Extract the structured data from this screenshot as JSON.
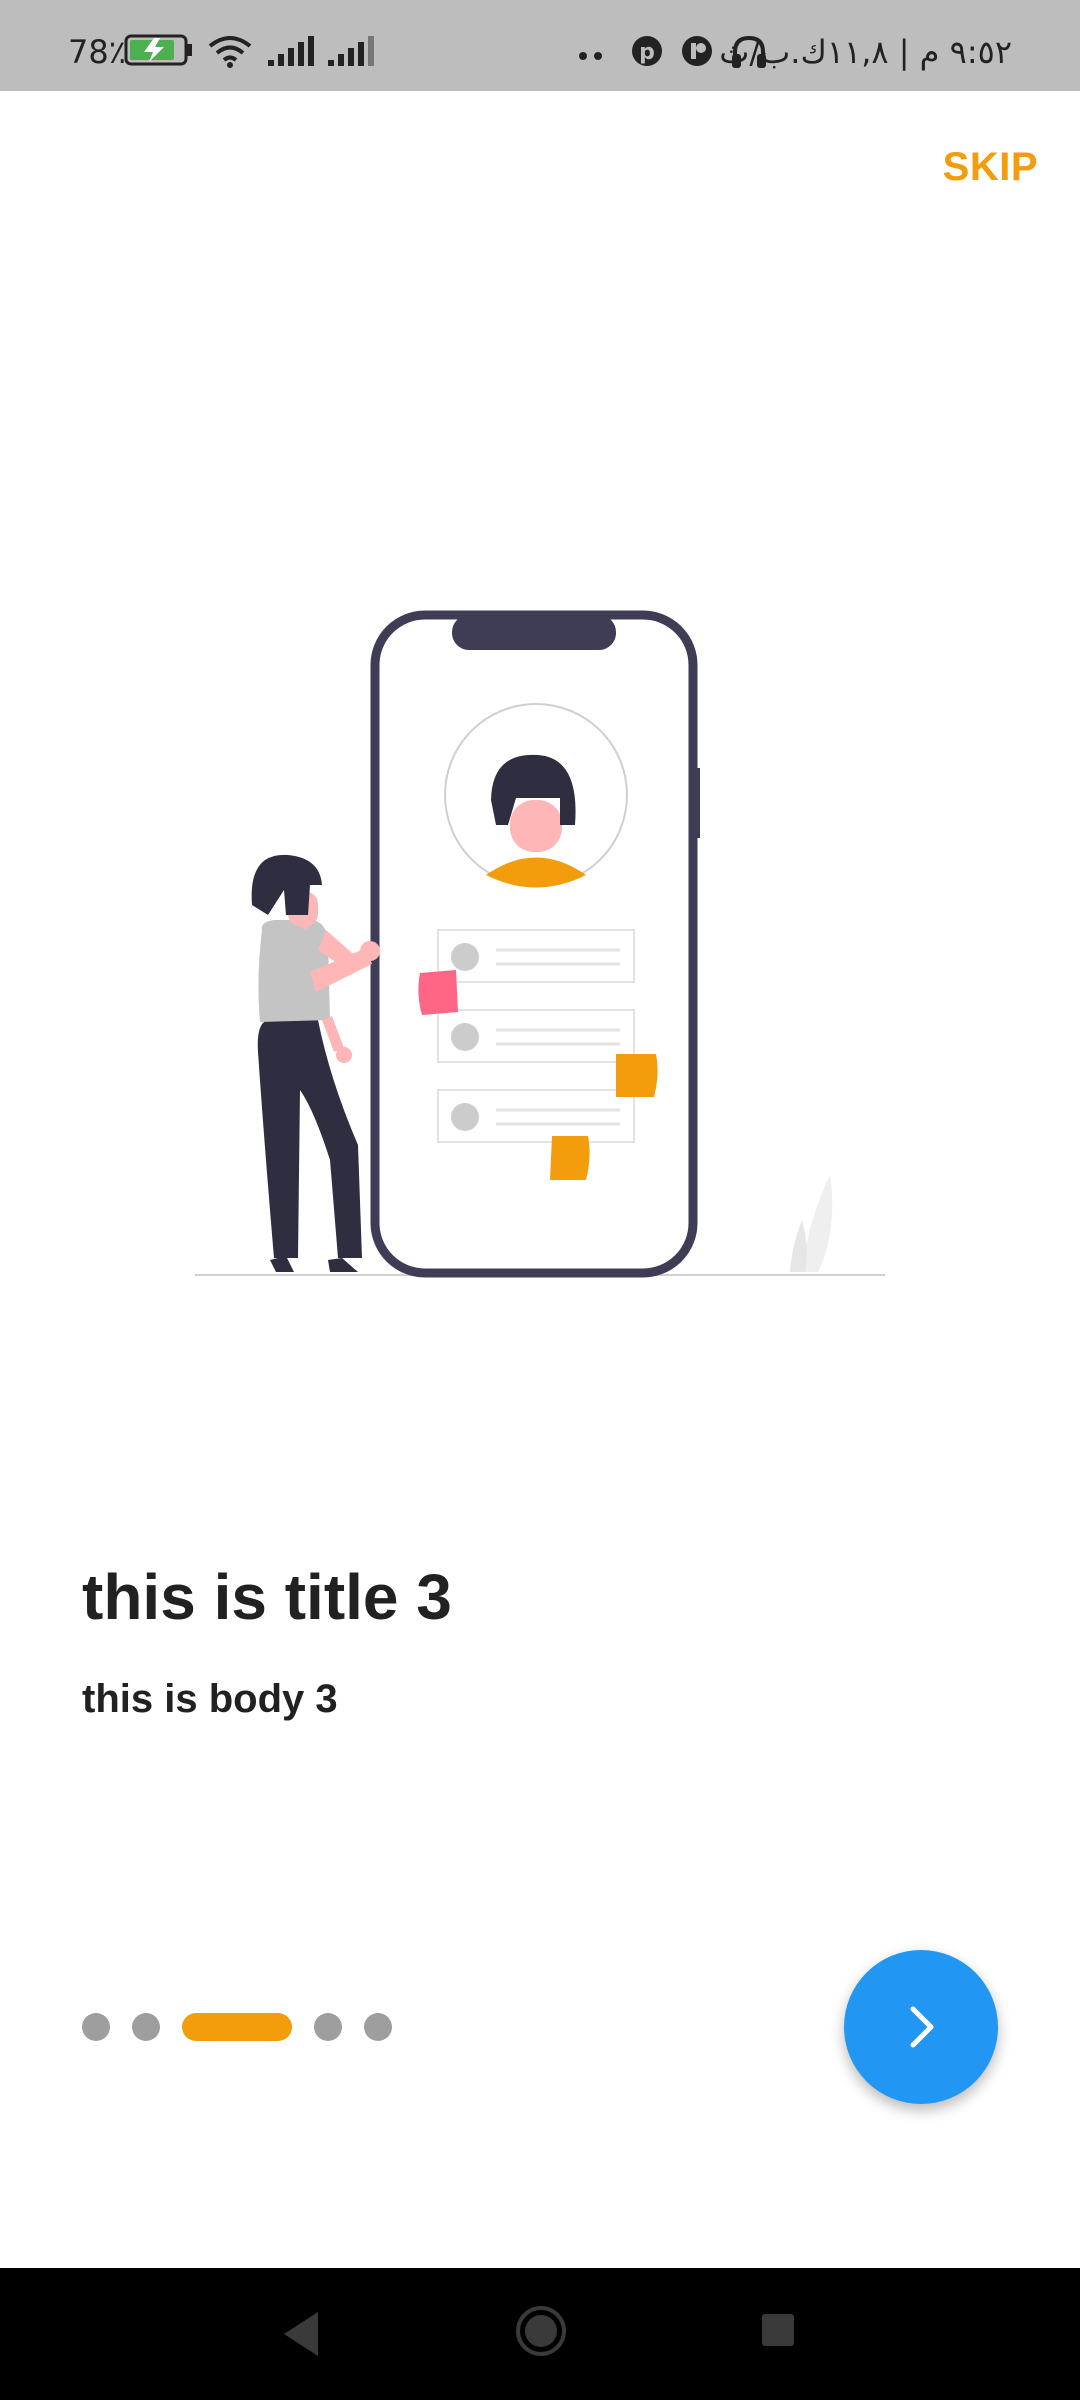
{
  "status_bar": {
    "battery": "78٪",
    "time_text": "٩:٥٢ م | ١١,٨ك.ب/ث"
  },
  "onboarding": {
    "skip_label": "SKIP",
    "title": "this is title 3",
    "body": "this is body 3",
    "page_count": 5,
    "active_page": 3
  },
  "icons": {
    "next": "chevron-right-icon",
    "nav_back": "triangle-back-icon",
    "nav_home": "circle-home-icon",
    "nav_recents": "square-recents-icon"
  },
  "colors": {
    "accent": "#f39c0c",
    "fab": "#2196f3",
    "indicator_inactive": "#9e9e9e",
    "text": "#212121"
  }
}
